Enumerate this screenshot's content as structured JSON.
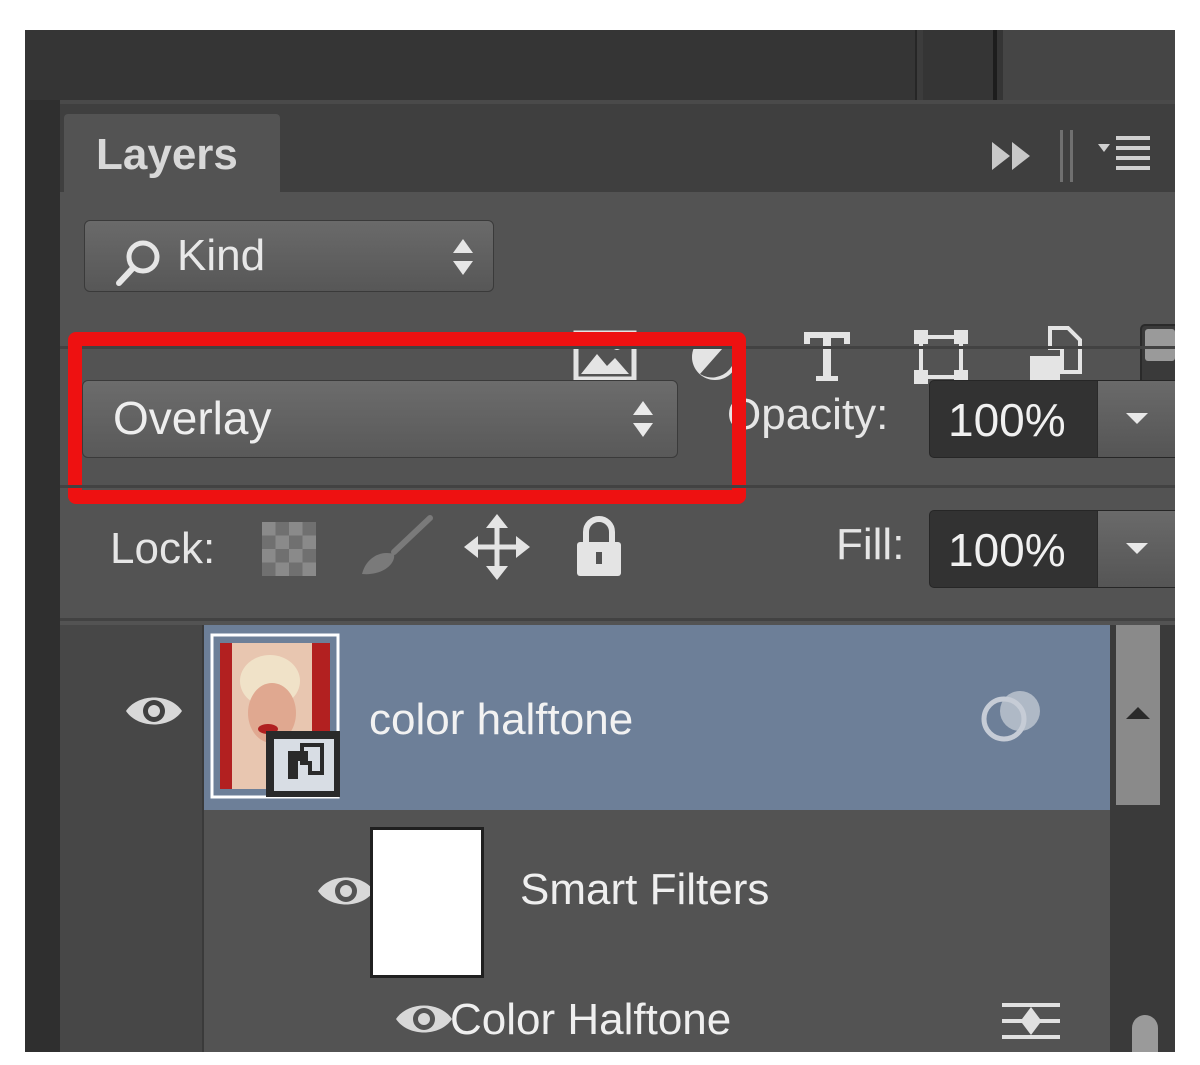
{
  "panel": {
    "tab_label": "Layers"
  },
  "filter": {
    "kind_label": "Kind",
    "icons": [
      "image-filter-icon",
      "adjustment-filter-icon",
      "type-filter-icon",
      "shape-filter-icon",
      "smart-object-filter-icon"
    ]
  },
  "blending": {
    "mode": "Overlay",
    "opacity_label": "Opacity:",
    "opacity_value": "100%",
    "lock_label": "Lock:",
    "fill_label": "Fill:",
    "fill_value": "100%"
  },
  "layers": [
    {
      "name": "color halftone",
      "selected": true,
      "type": "smart-object"
    },
    {
      "name": "Smart Filters",
      "type": "smart-filters"
    },
    {
      "name": "Color Halftone",
      "type": "filter"
    }
  ],
  "colors": {
    "highlight": "#ee1111",
    "selected_row": "#6d7f98",
    "panel": "#535353"
  }
}
